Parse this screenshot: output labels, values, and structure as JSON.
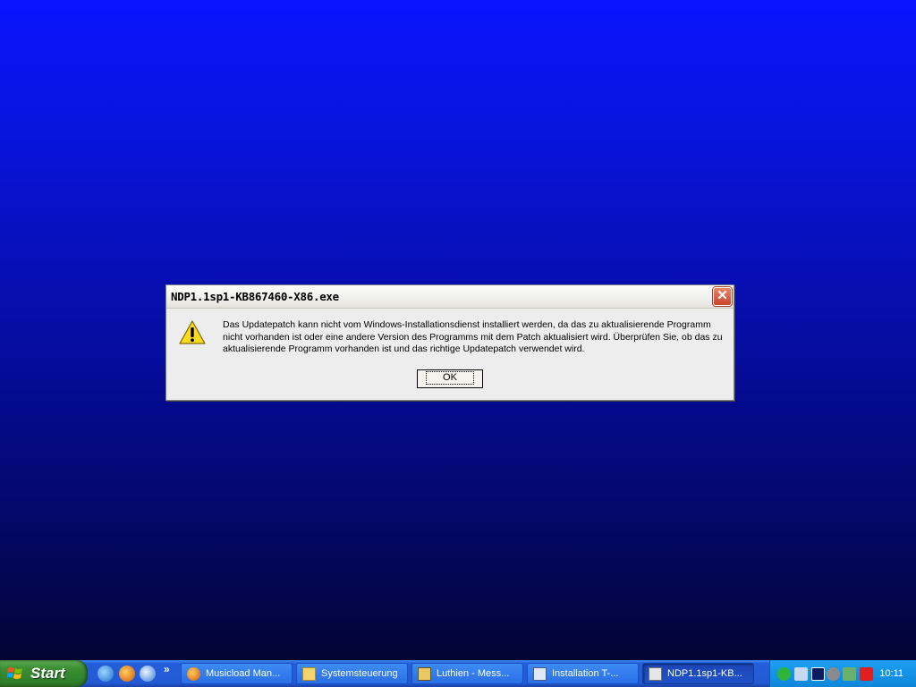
{
  "dialog": {
    "title": "NDP1.1sp1-KB867460-X86.exe",
    "close_label": "✕",
    "message": "Das Updatepatch kann nicht vom Windows-Installationsdienst installiert werden, da das zu aktualisierende Programm nicht vorhanden ist oder eine andere Version des Programms mit dem Patch aktualisiert wird. Überprüfen Sie, ob das zu aktualisierende Programm vorhanden ist und das richtige Updatepatch verwendet wird.",
    "ok_label": "OK",
    "icon": "warning-icon"
  },
  "taskbar": {
    "start_label": "Start",
    "quick_launch": [
      "ie-icon",
      "firefox-icon",
      "outlook-icon"
    ],
    "chevron": "»",
    "tasks": [
      {
        "label": "Musicload Man...",
        "icon": "firefox-icon"
      },
      {
        "label": "Systemsteuerung",
        "icon": "folder-icon"
      },
      {
        "label": "Luthien - Mess...",
        "icon": "messenger-icon"
      },
      {
        "label": "Installation T-...",
        "icon": "installer-icon"
      },
      {
        "label": "NDP1.1sp1-KB...",
        "icon": "setup-icon",
        "active": true
      }
    ],
    "clock": "10:11"
  },
  "colors": {
    "desktop_top": "#0a14ff",
    "desktop_bottom": "#02032a",
    "taskbar": "#245edb",
    "start": "#3c8f33",
    "tray": "#1294e8"
  }
}
